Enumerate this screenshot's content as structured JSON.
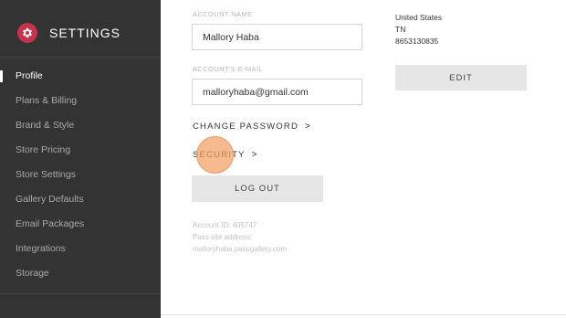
{
  "sidebar": {
    "title": "SETTINGS",
    "icon": "gear-icon",
    "items": [
      {
        "label": "Profile",
        "active": true
      },
      {
        "label": "Plans & Billing"
      },
      {
        "label": "Brand & Style"
      },
      {
        "label": "Store Pricing"
      },
      {
        "label": "Store Settings"
      },
      {
        "label": "Gallery Defaults"
      },
      {
        "label": "Email Packages"
      },
      {
        "label": "Integrations"
      },
      {
        "label": "Storage"
      }
    ]
  },
  "profile": {
    "account_name_label": "ACCOUNT NAME",
    "account_name_value": "Mallory Haba",
    "email_label": "ACCOUNT'S E-MAIL",
    "email_value": "malloryhaba@gmail.com",
    "change_password": "CHANGE PASSWORD",
    "security": "SECURITY",
    "logout": "LOG OUT",
    "account_id": "Account ID: 405747",
    "pass_site_label": "Pass site address:",
    "pass_site_value": "malloryhaba.passgallery.com"
  },
  "address": {
    "country": "United States",
    "state": "TN",
    "phone": "8653130835",
    "edit": "EDIT"
  },
  "colors": {
    "sidebar_bg": "#333333",
    "brand_accent": "#c8324a",
    "button_bg": "#e6e6e6",
    "click_indicator": "#f3a064"
  }
}
